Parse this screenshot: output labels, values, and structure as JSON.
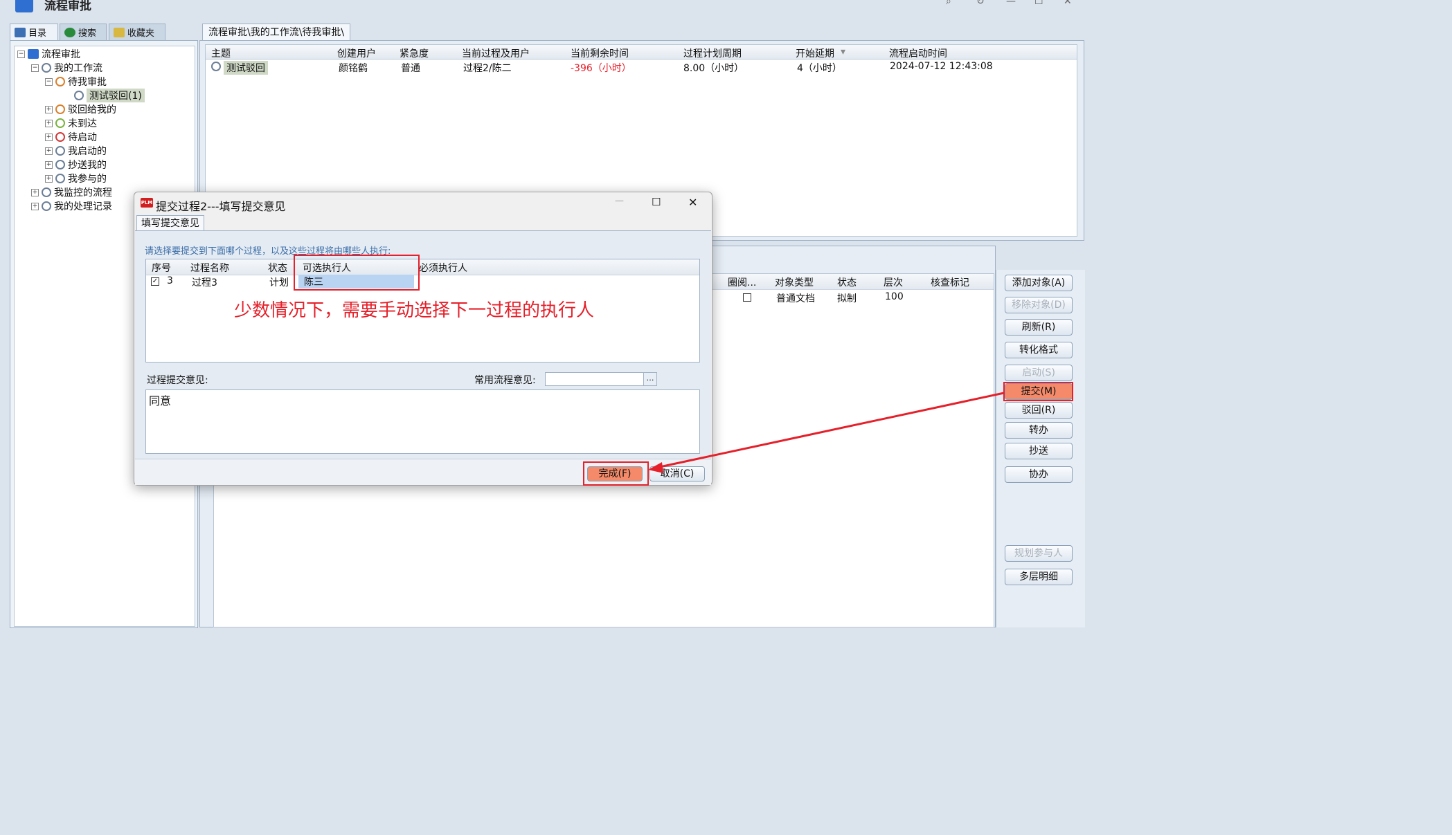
{
  "app": {
    "title": "流程审批"
  },
  "left_tabs": [
    "目录",
    "搜索",
    "收藏夹"
  ],
  "tree": {
    "root": "流程审批",
    "my_workflow": "我的工作流",
    "pending": "待我审批",
    "pending_child": "测试驳回(1)",
    "items": [
      "驳回给我的",
      "未到达",
      "待启动",
      "我启动的",
      "抄送我的",
      "我参与的"
    ],
    "monitor": "我监控的流程",
    "history": "我的处理记录"
  },
  "breadcrumb": "流程审批\\我的工作流\\待我审批\\",
  "grid": {
    "headers": [
      "主题",
      "创建用户",
      "紧急度",
      "当前过程及用户",
      "当前剩余时间",
      "过程计划周期",
      "开始延期",
      "流程启动时间"
    ],
    "row": [
      "测试驳回",
      "颜铭鹤",
      "普通",
      "过程2/陈二",
      "-396（小时）",
      "8.00（小时）",
      "4（小时）",
      "2024-07-12 12:43:08"
    ],
    "overdue_color": "#e5202a"
  },
  "object_grid": {
    "headers": [
      "圈阅...",
      "对象类型",
      "状态",
      "层次",
      "核查标记"
    ],
    "row": [
      "",
      "普通文档",
      "拟制",
      "100",
      ""
    ]
  },
  "buttons": {
    "add": "添加对象(A)",
    "remove": "移除对象(D)",
    "refresh": "刷新(R)",
    "convert": "转化格式",
    "start": "启动(S)",
    "submit": "提交(M)",
    "reject": "驳回(R)",
    "transfer": "转办",
    "cc": "抄送",
    "assist": "协办",
    "plan": "规划参与人",
    "detail": "多层明细"
  },
  "dialog": {
    "title": "提交过程2---填写提交意见",
    "tab": "填写提交意见",
    "prompt": "请选择要提交到下面哪个过程，以及这些过程将由哪些人执行:",
    "table_headers": [
      "序号",
      "过程名称",
      "状态",
      "可选执行人",
      "必须执行人"
    ],
    "row": [
      "3",
      "过程3",
      "计划",
      "陈三",
      ""
    ],
    "opinion_label": "过程提交意见:",
    "common_label": "常用流程意见:",
    "opinion_value": "同意",
    "ok": "完成(F)",
    "cancel": "取消(C)"
  },
  "annotation": "少数情况下，需要手动选择下一过程的执行人",
  "colors": {
    "accent_red": "#e5202a",
    "orange_button": "#f48a6a",
    "selection": "#b9d3f2"
  }
}
